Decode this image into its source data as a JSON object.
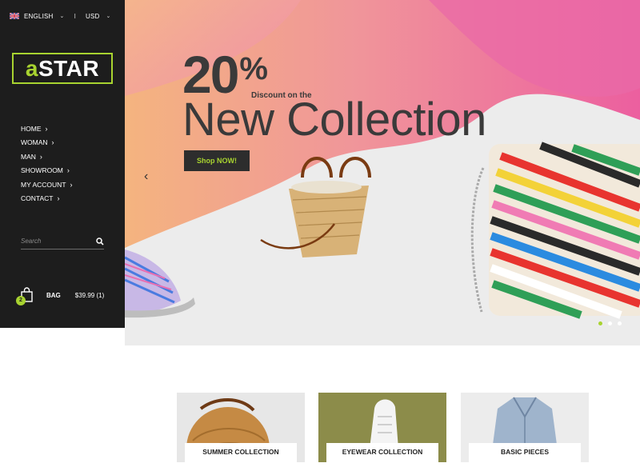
{
  "topbar": {
    "language": "ENGLISH",
    "separator": "I",
    "currency": "USD"
  },
  "logo": {
    "accent": "a",
    "rest": "STAR"
  },
  "nav": {
    "items": [
      {
        "label": "HOME"
      },
      {
        "label": "WOMAN"
      },
      {
        "label": "MAN"
      },
      {
        "label": "SHOWROOM"
      },
      {
        "label": "MY ACCOUNT"
      },
      {
        "label": "CONTACT"
      }
    ]
  },
  "search": {
    "placeholder": "Search"
  },
  "bag": {
    "count": "2",
    "label": "BAG",
    "total": "$39.99 (1)"
  },
  "hero": {
    "percent": "20",
    "percent_sign": "%",
    "discount": "Discount on the",
    "headline": "New Collection",
    "cta": "Shop NOW!",
    "prev_arrow": "‹",
    "active_slide": 0,
    "slide_count": 3
  },
  "collections": [
    {
      "label": "SUMMER COLLECTION"
    },
    {
      "label": "EYEWEAR COLLECTION"
    },
    {
      "label": "BASIC PIECES"
    }
  ],
  "colors": {
    "accent": "#a8d330",
    "sidebar": "#1d1d1d",
    "hero_pink": "#ec75b0",
    "hero_orange": "#f4b47f",
    "button": "#2d2d2d"
  },
  "icons": {
    "flag": "uk-flag-icon",
    "caret": "chevron-down-icon",
    "nav_chevron": "chevron-right-icon",
    "search": "search-icon",
    "bag": "shopping-bag-icon",
    "prev": "chevron-left-icon"
  }
}
